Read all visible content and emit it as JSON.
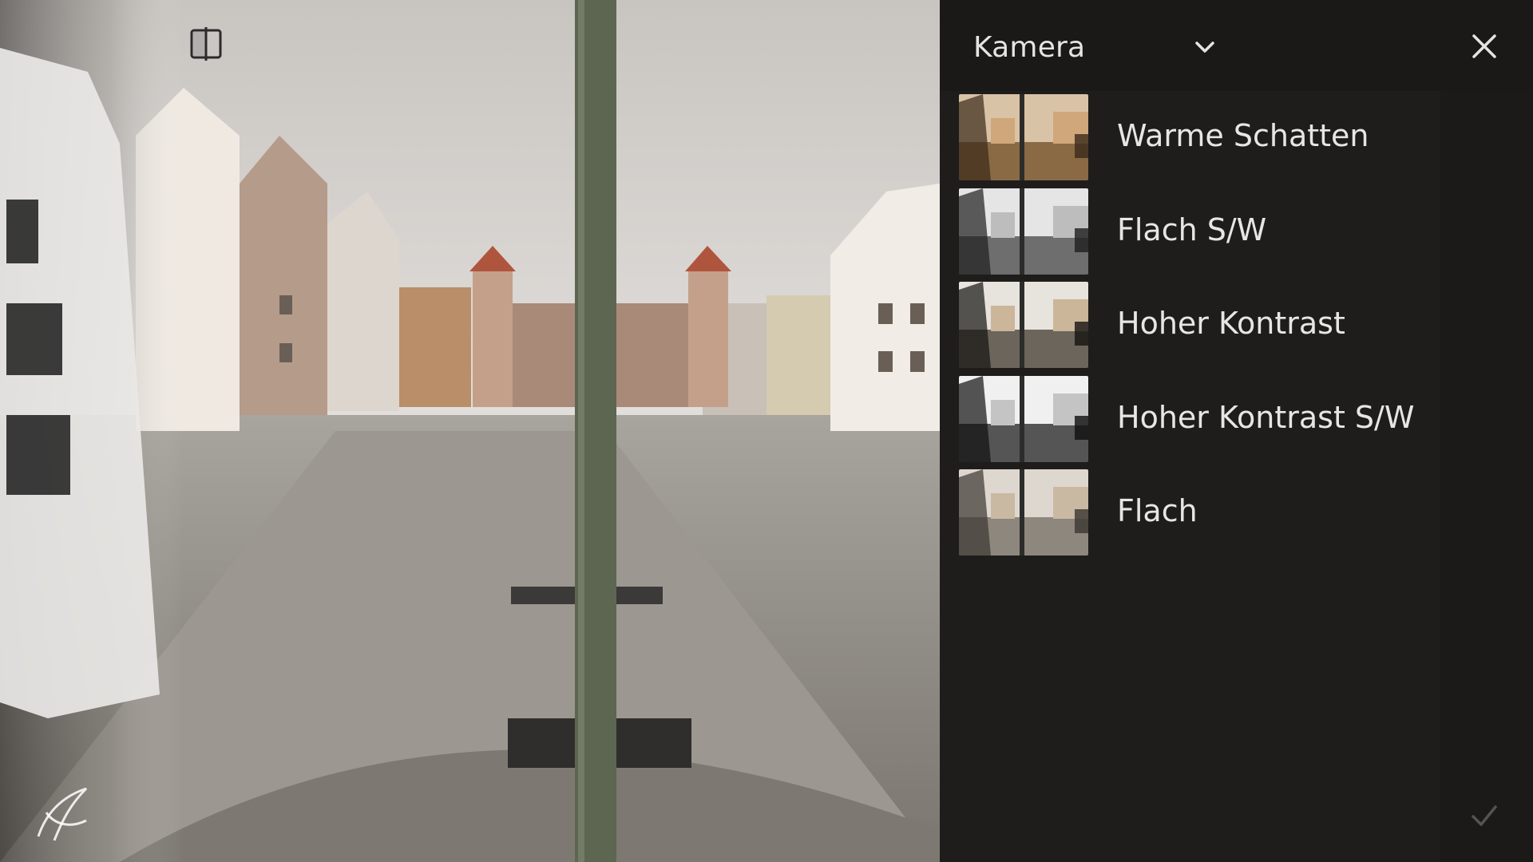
{
  "panel": {
    "group_label": "Kamera",
    "dropdown_icon": "chevron-down-icon",
    "close_icon": "close-icon",
    "confirm_icon": "checkmark-icon",
    "profiles": [
      {
        "label": "Warme Schatten",
        "tone": "warm"
      },
      {
        "label": "Flach S/W",
        "tone": "bw"
      },
      {
        "label": "Hoher Kontrast",
        "tone": "contrast"
      },
      {
        "label": "Hoher Kontrast S/W",
        "tone": "bw-contrast"
      },
      {
        "label": "Flach",
        "tone": "flat"
      }
    ]
  },
  "photo": {
    "compare_icon": "before-after-compare-icon",
    "watermark_icon": "brand-logo-icon"
  },
  "colors": {
    "panel_bg": "#1e1c1a",
    "text": "#e8e6e2",
    "icon": "#d9d7d3"
  }
}
